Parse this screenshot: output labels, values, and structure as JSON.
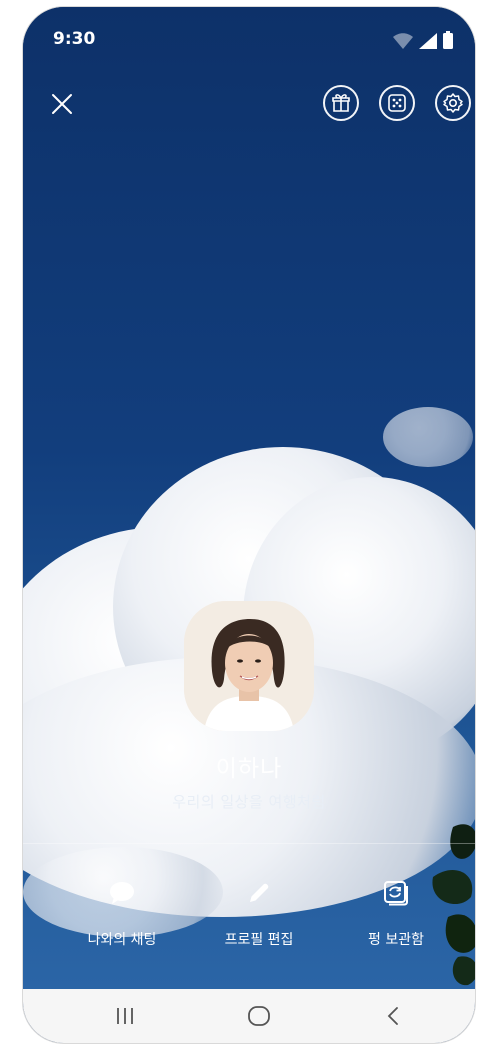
{
  "status_bar": {
    "time": "9:30"
  },
  "topbar": {
    "close_icon": "close-icon",
    "buttons": [
      "gift-icon",
      "dice-icon",
      "gear-icon"
    ]
  },
  "profile": {
    "name": "이하나",
    "status_message": "우리의 일상을 여행처럼"
  },
  "actions": [
    {
      "label": "나와의 채팅",
      "icon": "chat-bubble-icon"
    },
    {
      "label": "프로필 편집",
      "icon": "pencil-icon"
    },
    {
      "label": "펑 보관함",
      "icon": "archive-icon"
    }
  ],
  "navbar": [
    "recent-apps-icon",
    "home-icon",
    "back-icon"
  ],
  "colors": {
    "sky": "#123e7d",
    "cloud": "#eef1f6",
    "navbar": "#f6f6f6"
  }
}
